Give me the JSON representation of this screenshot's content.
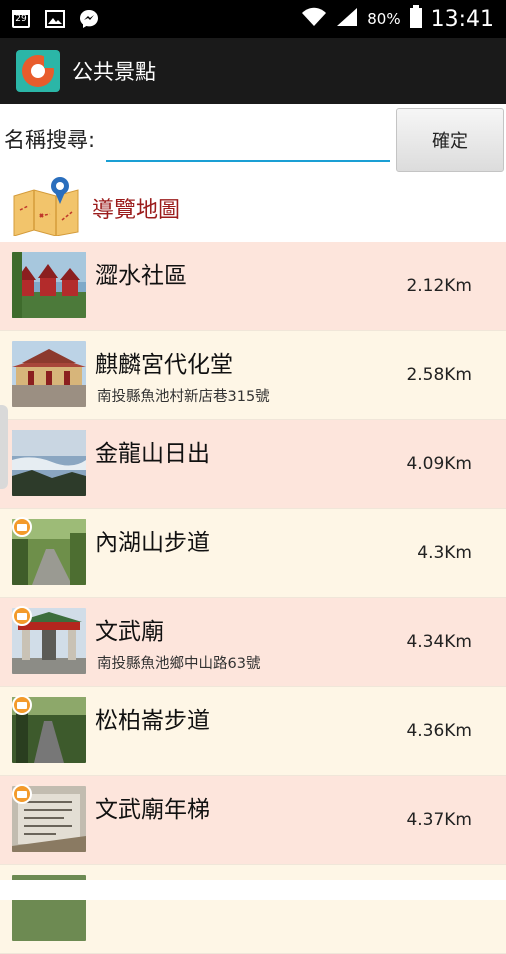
{
  "status_bar": {
    "notif_date": "29",
    "battery_text": "80%",
    "time": "13:41",
    "icons": [
      "calendar-icon",
      "gallery-icon",
      "messenger-icon",
      "wifi-icon",
      "signal-icon",
      "battery-icon"
    ]
  },
  "app_bar": {
    "title": "公共景點",
    "icon_colors": {
      "bg": "#2bb6a7",
      "ring": "#e85c2c"
    }
  },
  "search": {
    "label": "名稱搜尋:",
    "value": "",
    "placeholder": "",
    "confirm_label": "確定"
  },
  "map_link": {
    "label": "導覽地圖",
    "color": "#9b1c1c"
  },
  "colors": {
    "row_pink": "#fde5dc",
    "row_cream": "#fef6e6",
    "input_underline": "#1a9fd4",
    "badge": "#f39a2b"
  },
  "list": [
    {
      "name": "澀水社區",
      "address": "",
      "distance": "2.12Km",
      "badge": false
    },
    {
      "name": "麒麟宮代化堂",
      "address": "南投縣魚池村新店巷315號",
      "distance": "2.58Km",
      "badge": false
    },
    {
      "name": "金龍山日出",
      "address": "",
      "distance": "4.09Km",
      "badge": false
    },
    {
      "name": "內湖山步道",
      "address": "",
      "distance": "4.3Km",
      "badge": true
    },
    {
      "name": "文武廟",
      "address": "南投縣魚池鄉中山路63號",
      "distance": "4.34Km",
      "badge": true
    },
    {
      "name": "松柏崙步道",
      "address": "",
      "distance": "4.36Km",
      "badge": true
    },
    {
      "name": "文武廟年梯",
      "address": "",
      "distance": "4.37Km",
      "badge": true
    }
  ]
}
